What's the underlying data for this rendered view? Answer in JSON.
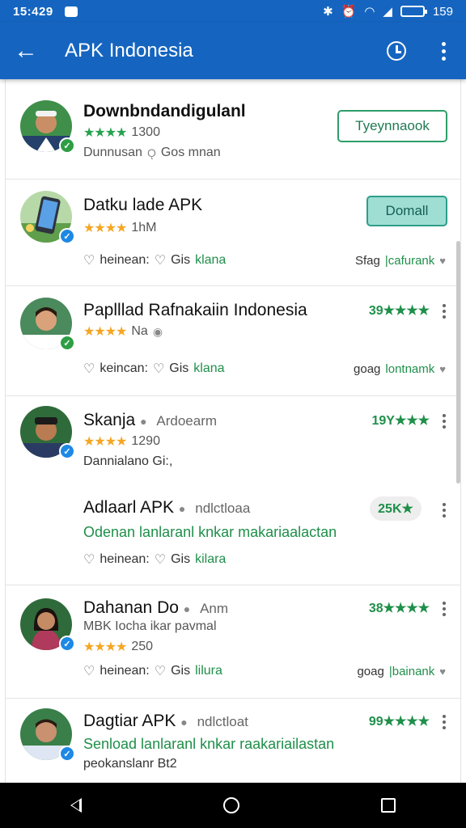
{
  "status": {
    "time": "15:429",
    "battery_text": "159",
    "battery_level": 0.9
  },
  "appbar": {
    "title": "APK Indonesia"
  },
  "icons": {
    "back": "arrow-left-icon",
    "timer": "timer-icon",
    "more": "more-vertical-icon",
    "verified": "check-badge-icon",
    "heart": "heart-icon",
    "like": "thumb-icon"
  },
  "colors": {
    "primary": "#1565c0",
    "green": "#1f8f4a",
    "gold": "#f5a623"
  },
  "items": [
    {
      "title": "Downbndandigulanl",
      "stars": "★★★★",
      "rating_count": "1300",
      "subtitle": "Dunnusan",
      "subtitle_icon": "Ǫ",
      "subtitle2": "Gos mnan",
      "button": "Tyeynnaook"
    },
    {
      "title": "Datku lade APK",
      "stars": "★★★★",
      "rating_count": "1hM",
      "action1": "heinean:",
      "action2_pre": "Gis",
      "action2_green": "klana",
      "link_pre": "Sfag",
      "link_green": "|cafurank",
      "button": "Domall"
    },
    {
      "title": "Paplllad Rafnakaiin Indonesia",
      "stars": "★★★★",
      "rating_count": "Na",
      "rating_right": "39★★★★",
      "action1": "keincan:",
      "action2_pre": "Gis",
      "action2_green": "klana",
      "link_pre": "goag",
      "link_green": "lontnamk"
    },
    {
      "title": "Skanja",
      "title_suffix": "Ardoearm",
      "stars": "★★★★",
      "rating_count": "1290",
      "subtitle": "Dannialano Gi:,",
      "rating_right": "19Y★★★"
    },
    {
      "title": "Adlaarl APK",
      "title_suffix": "ndlctloaa",
      "green_line": "Odenan lanlaranl knkar makariaalactan",
      "action1": "heinean:",
      "action2_pre": "Gis",
      "action2_green": "kilara",
      "pill": "25K★"
    },
    {
      "title": "Dahanan Do",
      "title_suffix": "Anm",
      "subtitle": "MBK Iocha ikar pavmal",
      "stars": "★★★★",
      "rating_count": "250",
      "rating_right": "38★★★★",
      "action1": "heinean:",
      "action2_pre": "Gis",
      "action2_green": "lilura",
      "link_pre": "goag",
      "link_green": "|bainank"
    },
    {
      "title": "Dagtiar APK",
      "title_suffix": "ndlctloat",
      "green_line": "Senload lanlaranl knkar raakariailastan",
      "subtitle": "peokanslanr Bt2",
      "rating_right": "99★★★★"
    }
  ]
}
